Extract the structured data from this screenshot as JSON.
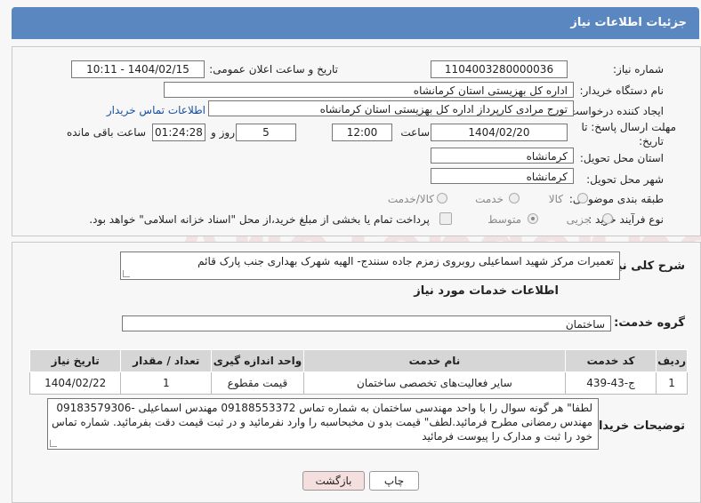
{
  "header": {
    "title": "جزئیات اطلاعات نیاز"
  },
  "fields": {
    "need_number_label": "شماره نیاز:",
    "need_number": "1104003280000036",
    "announce_label": "تاریخ و ساعت اعلان عمومی:",
    "announce_value": "1404/02/15 - 10:11",
    "buyer_org_label": "نام دستگاه خریدار:",
    "buyer_org": "اداره کل بهزیستی استان کرمانشاه",
    "creator_label": "ایجاد کننده درخواست:",
    "creator": "تورج مرادی کارپرداز  اداره کل بهزیستی استان کرمانشاه",
    "contact_link": "اطلاعات تماس خریدار",
    "deadline_label_1": "مهلت ارسال پاسخ: تا",
    "deadline_label_2": "تاریخ:",
    "deadline_date": "1404/02/20",
    "time_label": "ساعت",
    "deadline_time": "12:00",
    "days_value": "5",
    "days_label": "روز و",
    "remaining_time": "01:24:28",
    "remaining_label": "ساعت باقی مانده",
    "province_label": "استان محل تحویل:",
    "province": "کرمانشاه",
    "city_label": "شهر محل تحویل:",
    "city": "کرمانشاه",
    "category_label": "طبقه بندی موضوعی:",
    "category_options": [
      "کالا",
      "خدمت",
      "کالا/خدمت"
    ],
    "process_label": "نوع فرآیند خرید :",
    "process_options": [
      "جزیی",
      "متوسط"
    ],
    "payment_note": "پرداخت تمام یا بخشی از مبلغ خرید،از محل \"اسناد خزانه اسلامی\" خواهد بود."
  },
  "summary": {
    "label": "شرح کلی نیاز:",
    "text": "تعمیرات مرکز شهید اسماعیلی روبروی زمزم جاده سنندج- الهیه شهرک بهداری جنب پارک قائم"
  },
  "services": {
    "section_title": "اطلاعات خدمات مورد نیاز",
    "group_label": "گروه خدمت:",
    "group_value": "ساختمان",
    "columns": [
      "ردیف",
      "کد خدمت",
      "نام خدمت",
      "واحد اندازه گیری",
      "تعداد / مقدار",
      "تاریخ نیاز"
    ],
    "rows": [
      [
        "1",
        "ج-43-439",
        "سایر فعالیت‌های تخصصی ساختمان",
        "قیمت مقطوع",
        "1",
        "1404/02/22"
      ]
    ]
  },
  "buyer_notes": {
    "label": "توضیحات خریدار:",
    "line1": "لطفا\" هر گونه سوال را با واحد مهندسی ساختمان به شماره تماس 09188553372 مهندس اسماعیلی -09183579306",
    "line2": "مهندس رمضانی  مطرح فرمائید.لطف\" قیمت بدو ن مخبحاسبه را وارد نفرمائید و در ثبت قیمت دقت بفرمائید. شماره تماس",
    "line3": "خود را ثبت و مدارک را پیوست فرمائید"
  },
  "buttons": {
    "print": "چاپ",
    "back": "بازگشت"
  },
  "watermark": "AriaTender.neT",
  "colors": {
    "header": "#5b87c1",
    "link": "#1a4fa0",
    "back_button": "#f5dede"
  }
}
